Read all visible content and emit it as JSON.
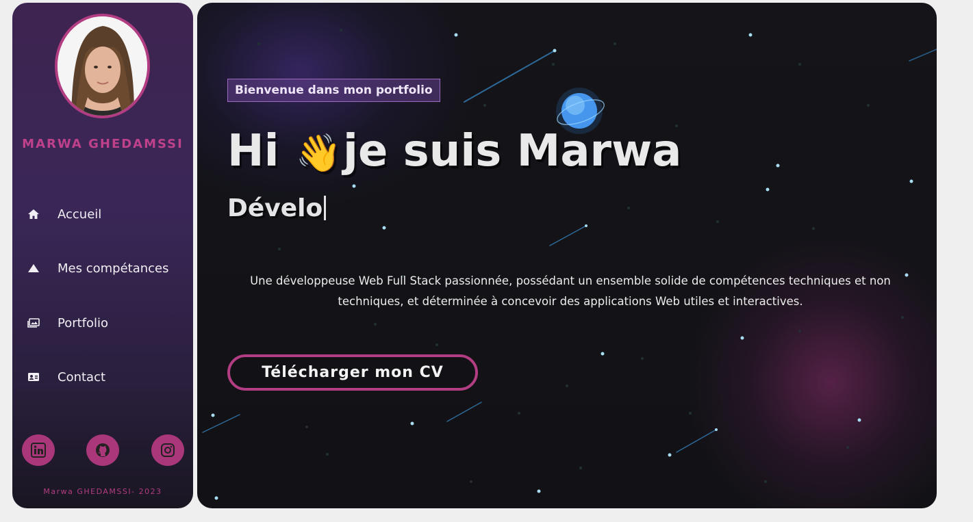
{
  "sidebar": {
    "name": "MARWA GHEDAMSSI",
    "nav": [
      {
        "label": "Accueil",
        "icon": "home-icon"
      },
      {
        "label": "Mes compétances",
        "icon": "triangle-icon"
      },
      {
        "label": "Portfolio",
        "icon": "image-icon"
      },
      {
        "label": "Contact",
        "icon": "contact-card-icon"
      }
    ],
    "socials": [
      "linkedin-icon",
      "github-icon",
      "instagram-icon"
    ],
    "footer": "Marwa GHEDAMSSI- 2023"
  },
  "hero": {
    "badge": "Bienvenue dans mon portfolio",
    "greeting": "Hi",
    "wave": "👋",
    "title_rest": "je suis Marwa",
    "typing": "Dévelo",
    "description": "Une développeuse Web Full Stack passionnée, possédant un ensemble solide de compétences techniques et non techniques, et déterminée à concevoir des applications Web utiles et interactives.",
    "cv_button": "Télécharger mon CV"
  },
  "colors": {
    "accent": "#b23d82",
    "sidebar_bg": "#3a2758",
    "main_bg": "#121216"
  }
}
